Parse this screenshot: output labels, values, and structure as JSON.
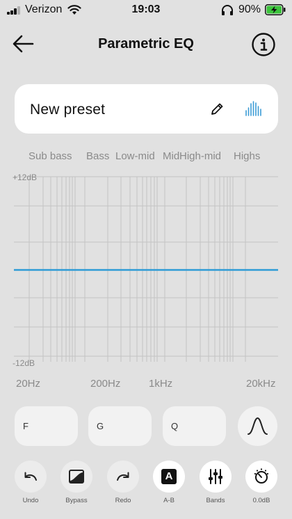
{
  "status_bar": {
    "carrier": "Verizon",
    "time": "19:03",
    "battery_percent": "90%",
    "battery_level": 0.9,
    "charging": true,
    "icons": [
      "signal-icon",
      "wifi-icon",
      "headphones-icon",
      "battery-charging-icon"
    ]
  },
  "header": {
    "title": "Parametric EQ",
    "back_icon": "arrow-left-icon",
    "info_icon": "info-circle-icon"
  },
  "preset": {
    "name": "New preset",
    "edit_icon": "pencil-icon",
    "bands_view_icon": "bar-levels-icon",
    "accent_color": "#3a9bd5"
  },
  "eq": {
    "band_labels": [
      "Sub bass",
      "Bass",
      "Low-mid",
      "Mid",
      "High-mid",
      "Highs"
    ],
    "gain_top": "+12dB",
    "gain_bottom": "-12dB",
    "gain_max": 12,
    "gain_min": -12,
    "curve_gain_db": 0,
    "curve_color": "#2e9bd6",
    "grid_color": "#c4c4c4",
    "freq_labels": [
      "20Hz",
      "200Hz",
      "1kHz",
      "20kHz"
    ]
  },
  "params": {
    "f_label": "F",
    "g_label": "G",
    "q_label": "Q",
    "filter_icon": "bell-curve-icon"
  },
  "toolbar": {
    "undo": "Undo",
    "bypass": "Bypass",
    "redo": "Redo",
    "ab": "A-B",
    "bands": "Bands",
    "gain": "0.0dB",
    "ab_letter": "A"
  }
}
